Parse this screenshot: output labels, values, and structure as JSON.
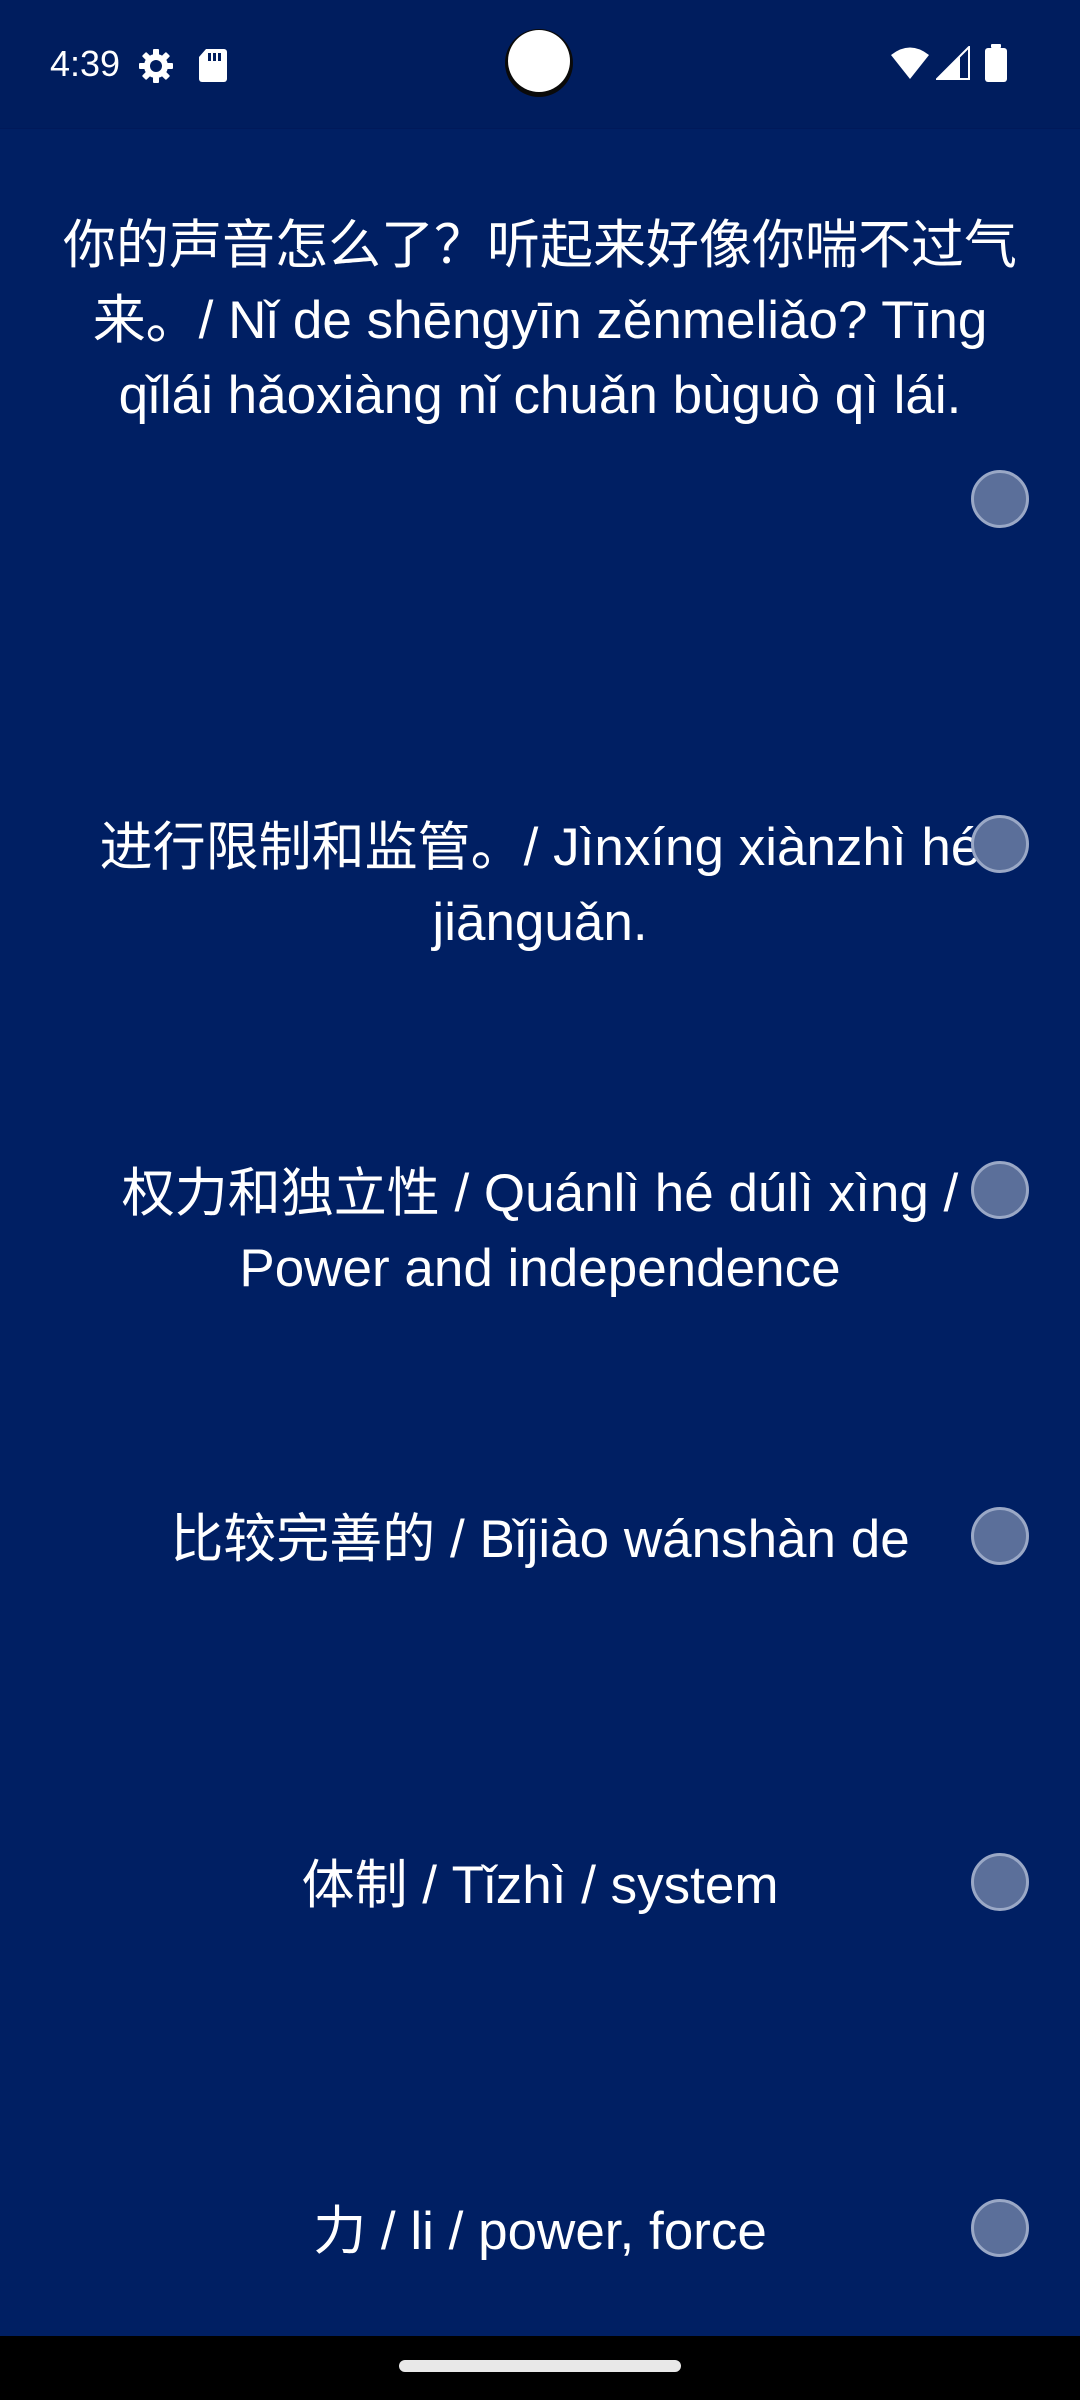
{
  "status_bar": {
    "time": "4:39",
    "icons": [
      "settings-gear-icon",
      "sd-card-icon",
      "wifi-icon",
      "cell-signal-icon",
      "battery-icon"
    ]
  },
  "colors": {
    "background": "#001f63",
    "text": "#ffffff",
    "radio_fill": "#5b6f9a",
    "radio_border": "#9aa8c6"
  },
  "items": [
    {
      "text": "你的声音怎么了？听起来好像你喘不过气来。/  Nǐ de shēngyīn zěnmeliǎo? Tīng qǐlái hǎoxiàng nǐ chuǎn bùguò qì lái."
    },
    {
      "text": "进行限制和监管。/ Jìnxíng xiànzhì hé jiānguǎn."
    },
    {
      "text": "权力和独立性 / Quánlì hé dúlì xìng / Power and independence"
    },
    {
      "text": "比较完善的 / Bǐjiào wánshàn de"
    },
    {
      "text": "体制 / Tǐzhì / system"
    },
    {
      "text": "力 / li / power, force"
    }
  ]
}
